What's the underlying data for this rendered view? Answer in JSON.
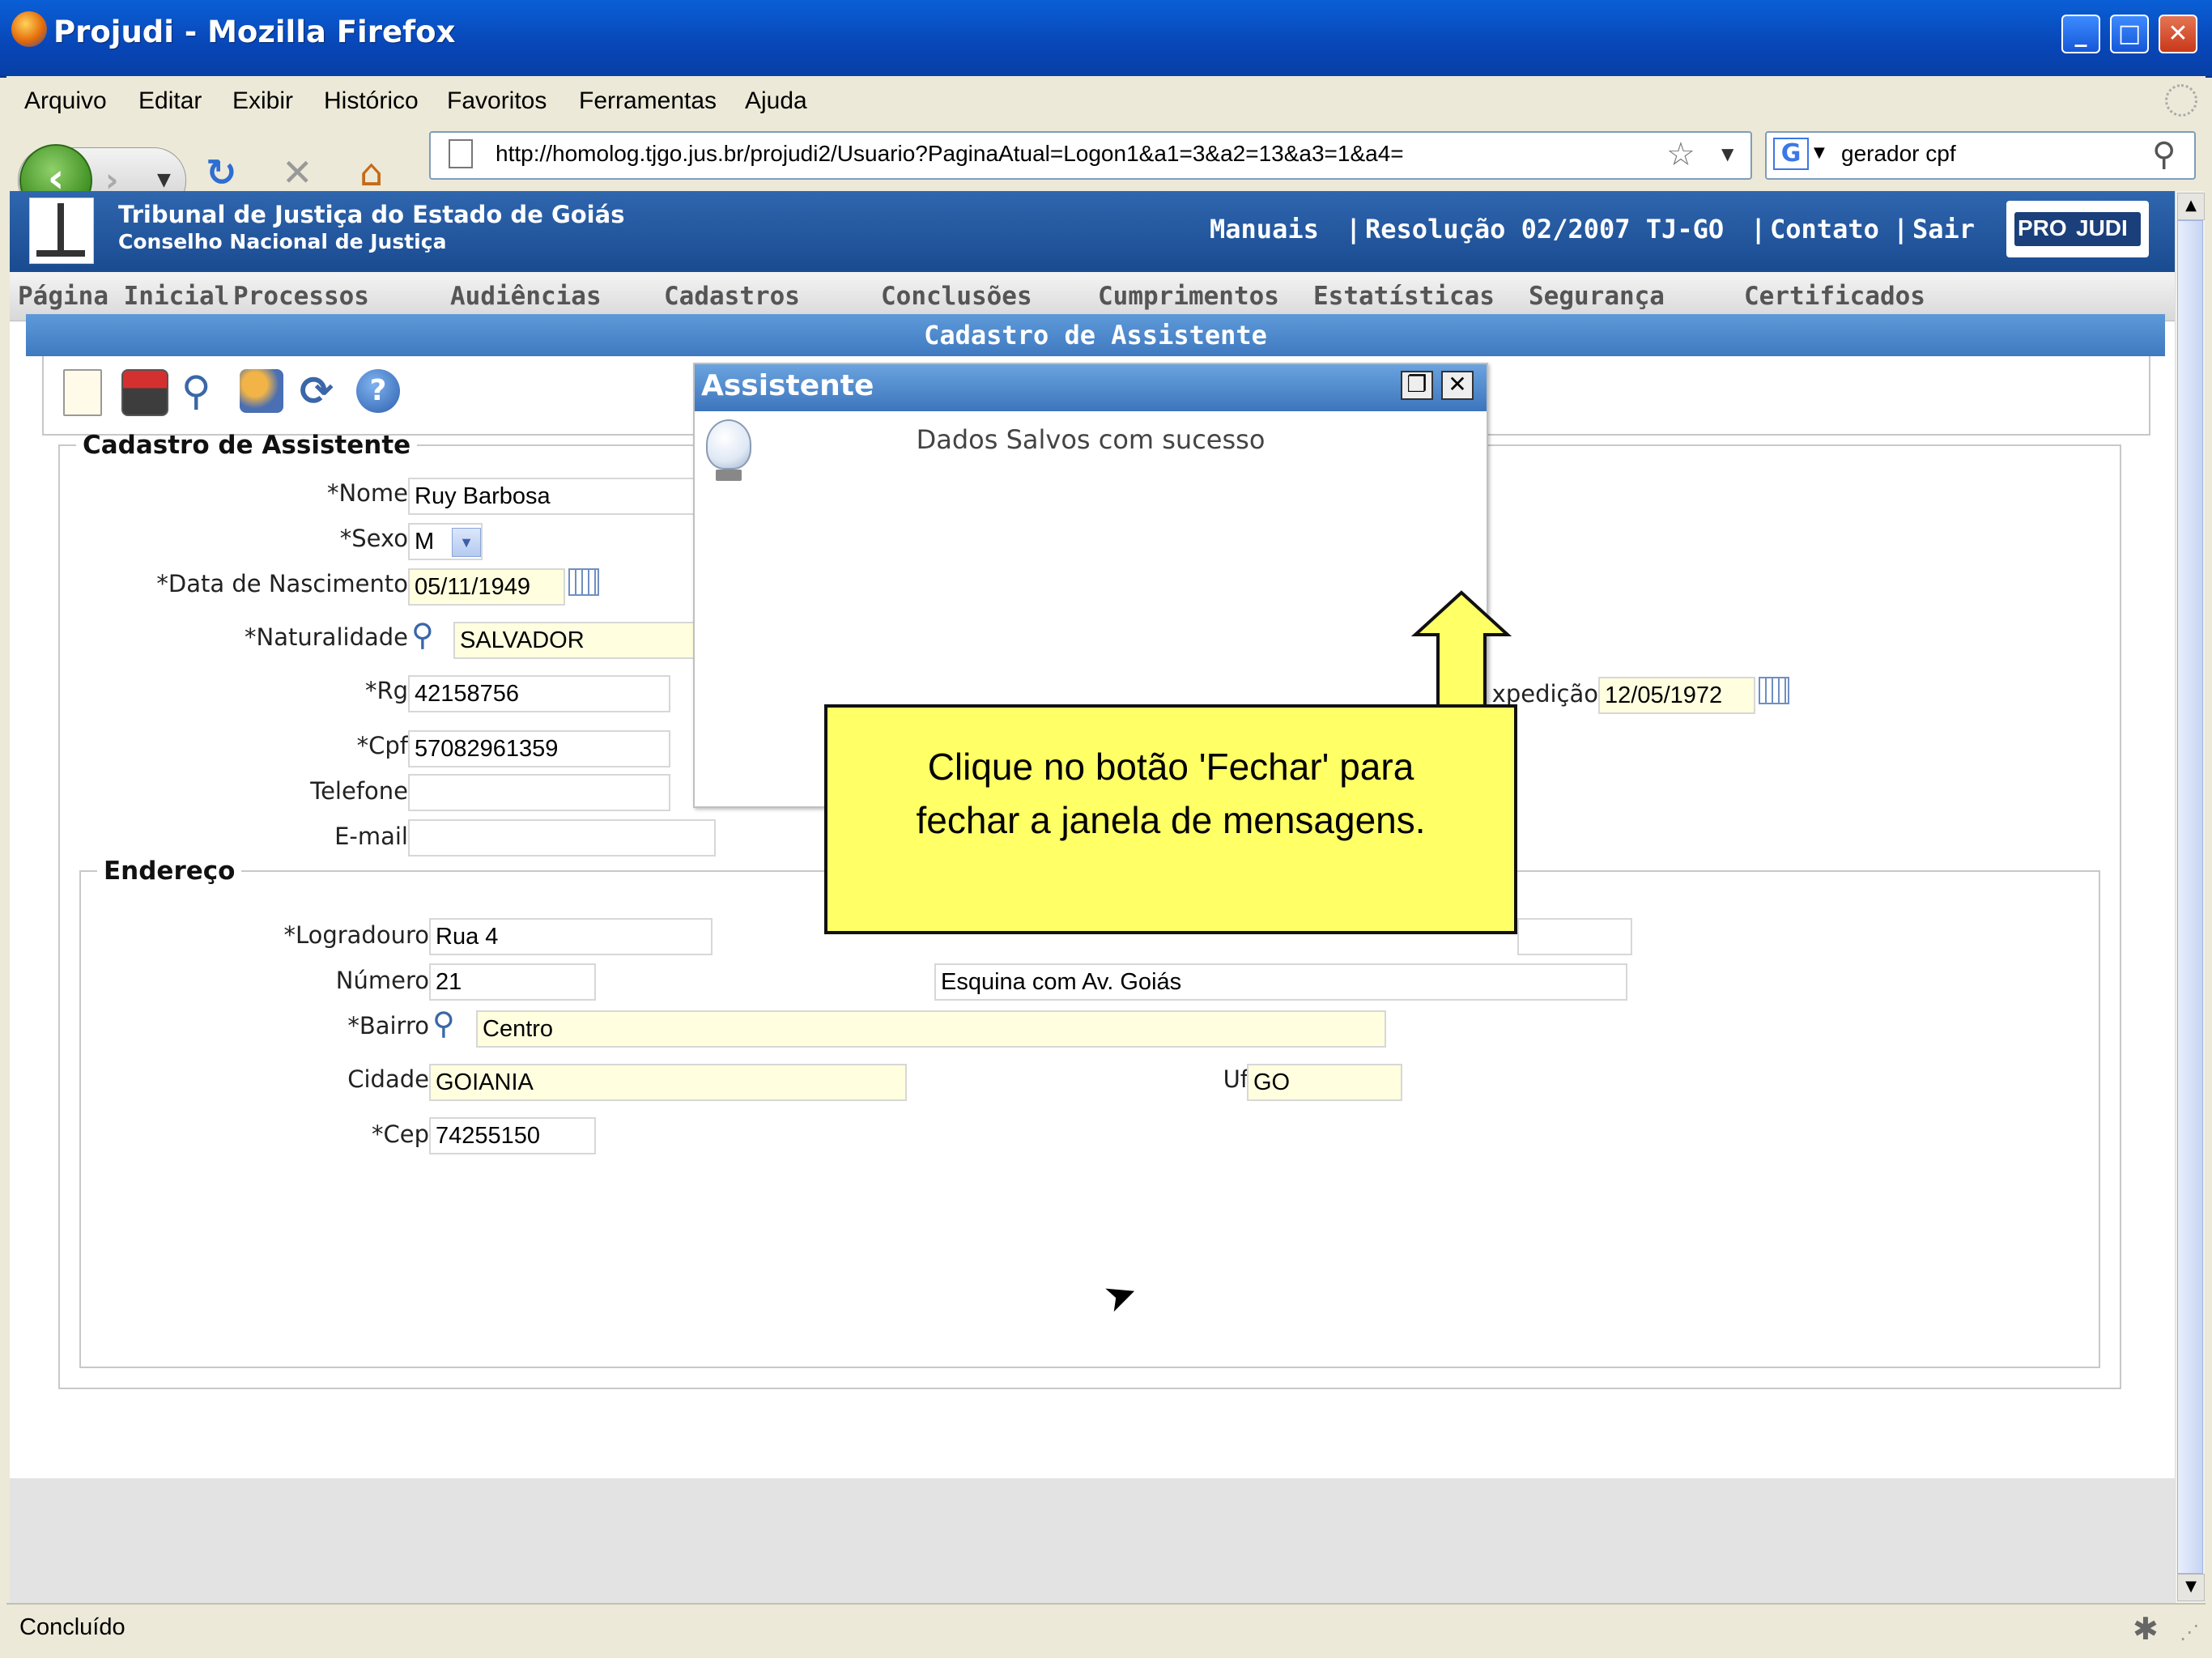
{
  "window": {
    "title": "Projudi - Mozilla Firefox"
  },
  "menu": [
    "Arquivo",
    "Editar",
    "Exibir",
    "Histórico",
    "Favoritos",
    "Ferramentas",
    "Ajuda"
  ],
  "address_bar": {
    "url": "http://homolog.tjgo.jus.br/projudi2/Usuario?PaginaAtual=Logon1&a1=3&a2=13&a3=1&a4="
  },
  "search_bar": {
    "value": "gerador cpf",
    "engine_icon": "G"
  },
  "site": {
    "title_line1": "Tribunal de Justiça do Estado de Goiás",
    "title_line2": "Conselho Nacional de Justiça",
    "links": [
      "Manuais",
      "Resolução 02/2007 TJ-GO",
      "Contato",
      "Sair"
    ],
    "logo_left": "PRO",
    "logo_right": "JUDI",
    "nav": [
      "Página Inicial",
      "Processos",
      "Audiências",
      "Cadastros",
      "Conclusões",
      "Cumprimentos",
      "Estatísticas",
      "Segurança",
      "Certificados"
    ],
    "page_title": "Cadastro de Assistente"
  },
  "form": {
    "legend": "Cadastro de Assistente",
    "nome_label": "*Nome",
    "nome": "Ruy Barbosa",
    "sexo_label": "*Sexo",
    "sexo": "M",
    "nasc_label": "*Data de Nascimento",
    "nasc": "05/11/1949",
    "natural_label": "*Naturalidade",
    "natural": "SALVADOR",
    "rg_label": "*Rg",
    "rg": "42158756",
    "expedicao_label": "xpedição",
    "expedicao": "12/05/1972",
    "cpf_label": "*Cpf",
    "cpf": "57082961359",
    "tel_label": "Telefone",
    "tel": "",
    "email_label": "E-mail",
    "email": ""
  },
  "endereco": {
    "legend": "Endereço",
    "logradouro_label": "*Logradouro",
    "logradouro": "Rua 4",
    "numero_label": "Número",
    "numero": "21",
    "complemento": "Esquina com Av. Goiás",
    "bairro_label": "*Bairro",
    "bairro": "Centro",
    "cidade_label": "Cidade",
    "cidade": "GOIANIA",
    "uf_label": "Uf",
    "uf": "GO",
    "cep_label": "*Cep",
    "cep": "74255150"
  },
  "dialog": {
    "title": "Assistente",
    "message": "Dados Salvos com sucesso"
  },
  "tooltip": {
    "line1": "Clique no botão 'Fechar' para",
    "line2": "fechar a janela de mensagens."
  },
  "status": {
    "text": "Concluído"
  },
  "colors": {
    "title_bar": "#0a5fd6",
    "site_header": "#2f66ae",
    "tooltip": "#ffff66",
    "readonly_field": "#ffffe0"
  }
}
